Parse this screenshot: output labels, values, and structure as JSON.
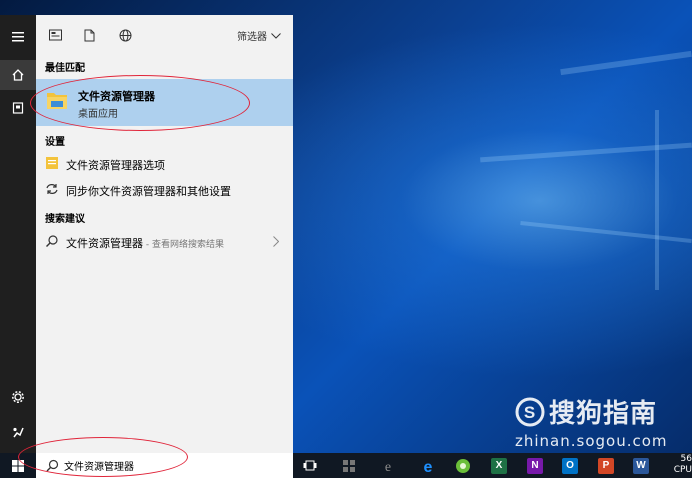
{
  "top_menu": {
    "filter_label": "筛选器"
  },
  "sections": {
    "best_match": "最佳匹配",
    "settings": "设置",
    "search_suggestions": "搜索建议"
  },
  "best_match": {
    "title": "文件资源管理器",
    "subtitle": "桌面应用"
  },
  "settings_items": [
    {
      "label": "文件资源管理器选项"
    },
    {
      "label": "同步你文件资源管理器和其他设置"
    }
  ],
  "suggestion": {
    "label": "文件资源管理器",
    "suffix": " - 查看网络搜索结果"
  },
  "search": {
    "value": "文件资源管理器"
  },
  "taskbar": {
    "apps": [
      {
        "name": "Excel",
        "letter": "X",
        "color": "#1e7145"
      },
      {
        "name": "OneNote",
        "letter": "N",
        "color": "#7719aa"
      },
      {
        "name": "Outlook",
        "letter": "O",
        "color": "#0072c6"
      },
      {
        "name": "PowerPoint",
        "letter": "P",
        "color": "#d24726"
      },
      {
        "name": "Word",
        "letter": "W",
        "color": "#2b579a"
      }
    ]
  },
  "watermark": {
    "brand": "搜狗指南",
    "url": "zhinan.sogou.com"
  },
  "clock": {
    "line1": "56",
    "line2": "CPU"
  },
  "annotation_color": "#e0253a"
}
